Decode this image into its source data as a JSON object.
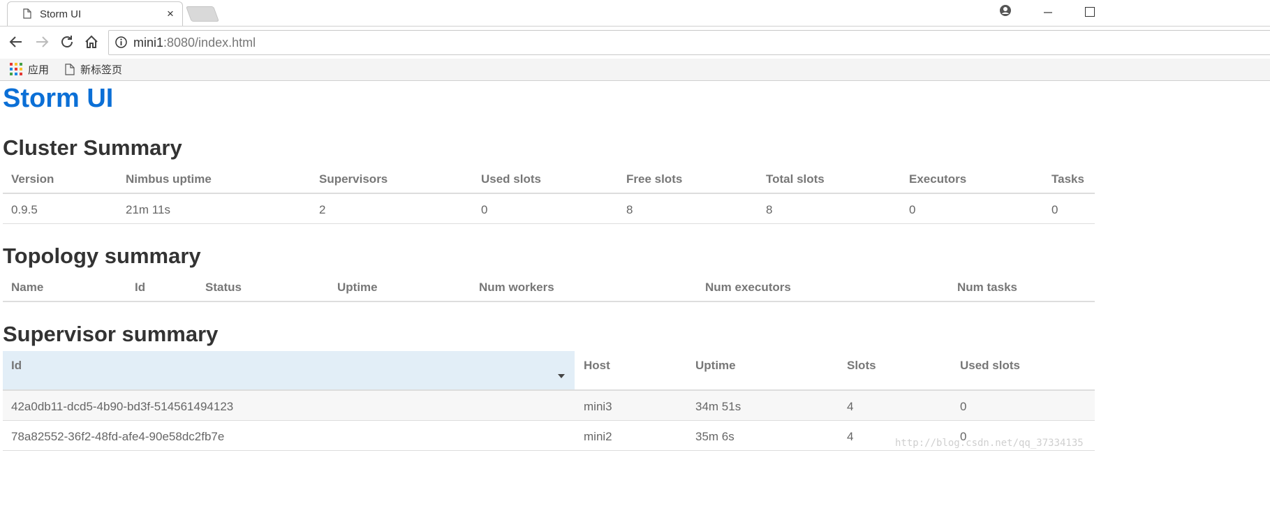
{
  "browser": {
    "tab_title": "Storm UI",
    "tab_close": "×",
    "url_host": "mini1",
    "url_rest": ":8080/index.html",
    "bookmarks": [
      {
        "label": "应用",
        "icon": "apps-grid-icon"
      },
      {
        "label": "新标签页",
        "icon": "page-icon"
      }
    ]
  },
  "page": {
    "title": "Storm UI",
    "cluster": {
      "heading": "Cluster Summary",
      "headers": [
        "Version",
        "Nimbus uptime",
        "Supervisors",
        "Used slots",
        "Free slots",
        "Total slots",
        "Executors",
        "Tasks"
      ],
      "row": [
        "0.9.5",
        "21m 11s",
        "2",
        "0",
        "8",
        "8",
        "0",
        "0"
      ]
    },
    "topology": {
      "heading": "Topology summary",
      "headers": [
        "Name",
        "Id",
        "Status",
        "Uptime",
        "Num workers",
        "Num executors",
        "Num tasks"
      ]
    },
    "supervisor": {
      "heading": "Supervisor summary",
      "headers": [
        "Id",
        "Host",
        "Uptime",
        "Slots",
        "Used slots"
      ],
      "rows": [
        [
          "42a0db11-dcd5-4b90-bd3f-514561494123",
          "mini3",
          "34m 51s",
          "4",
          "0"
        ],
        [
          "78a82552-36f2-48fd-afe4-90e58dc2fb7e",
          "mini2",
          "35m 6s",
          "4",
          "0"
        ]
      ]
    },
    "watermark": "http://blog.csdn.net/qq_37334135"
  }
}
